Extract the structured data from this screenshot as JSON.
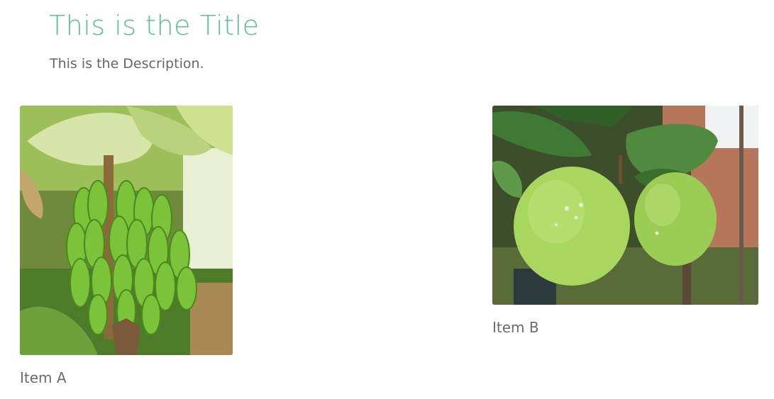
{
  "header": {
    "title": "This is the Title",
    "description": "This is the Description.",
    "title_color": "#5bbf97"
  },
  "items": [
    {
      "label": "Item A",
      "image_subject": "green-banana-bunch"
    },
    {
      "label": "Item B",
      "image_subject": "green-apples-on-branch"
    }
  ]
}
